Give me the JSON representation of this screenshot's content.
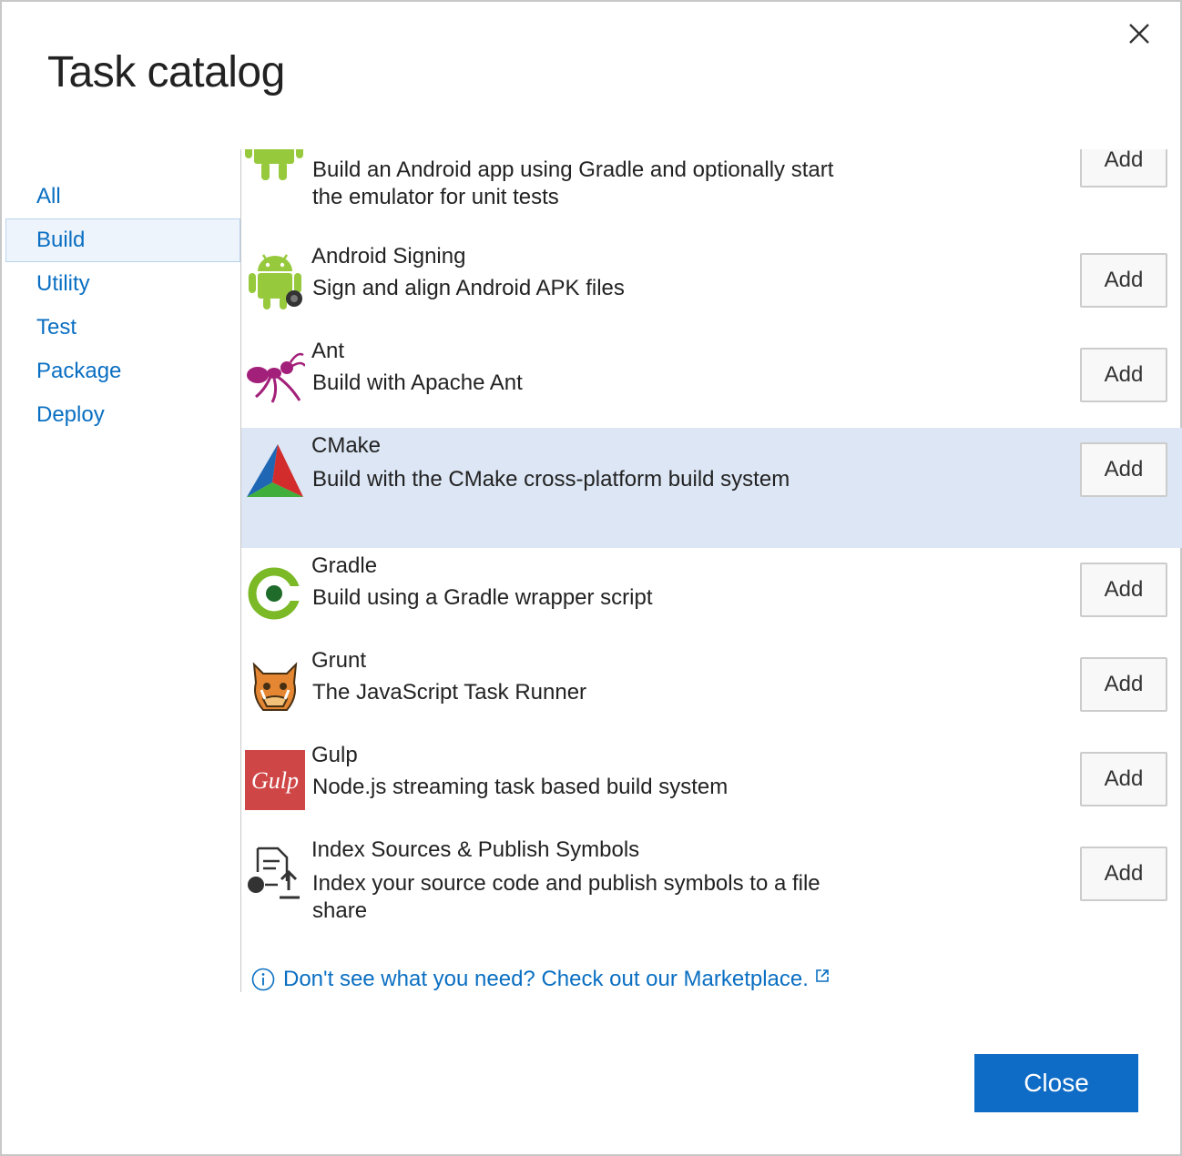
{
  "dialog": {
    "title": "Task catalog",
    "close_label": "Close"
  },
  "colors": {
    "accent": "#0f6cc6",
    "link": "#0a6fc2",
    "selected_row": "#dce6f4",
    "selected_category": "#eef4fb"
  },
  "categories": [
    {
      "label": "All",
      "selected": false
    },
    {
      "label": "Build",
      "selected": true
    },
    {
      "label": "Utility",
      "selected": false
    },
    {
      "label": "Test",
      "selected": false
    },
    {
      "label": "Package",
      "selected": false
    },
    {
      "label": "Deploy",
      "selected": false
    }
  ],
  "tasks": [
    {
      "name": "",
      "description": "Build an Android app using Gradle and optionally start the emulator for unit tests",
      "icon": "android-icon",
      "add_label": "Add"
    },
    {
      "name": "Android Signing",
      "description": "Sign and align Android APK files",
      "icon": "android-signing-icon",
      "add_label": "Add"
    },
    {
      "name": "Ant",
      "description": "Build with Apache Ant",
      "icon": "ant-icon",
      "add_label": "Add"
    },
    {
      "name": "CMake",
      "description": "Build with the CMake cross-platform build system",
      "icon": "cmake-icon",
      "add_label": "Add",
      "selected": true
    },
    {
      "name": "Gradle",
      "description": "Build using a Gradle wrapper script",
      "icon": "gradle-icon",
      "add_label": "Add"
    },
    {
      "name": "Grunt",
      "description": "The JavaScript Task Runner",
      "icon": "grunt-icon",
      "add_label": "Add"
    },
    {
      "name": "Gulp",
      "description": "Node.js streaming task based build system",
      "icon": "gulp-icon",
      "icon_text": "Gulp",
      "add_label": "Add"
    },
    {
      "name": "Index Sources & Publish Symbols",
      "description": "Index your source code and publish symbols to a file share",
      "icon": "index-symbols-icon",
      "add_label": "Add"
    }
  ],
  "marketplace": {
    "text": "Don't see what you need? Check out our Marketplace.",
    "icon": "info-icon",
    "external_icon": "external-link-icon"
  }
}
